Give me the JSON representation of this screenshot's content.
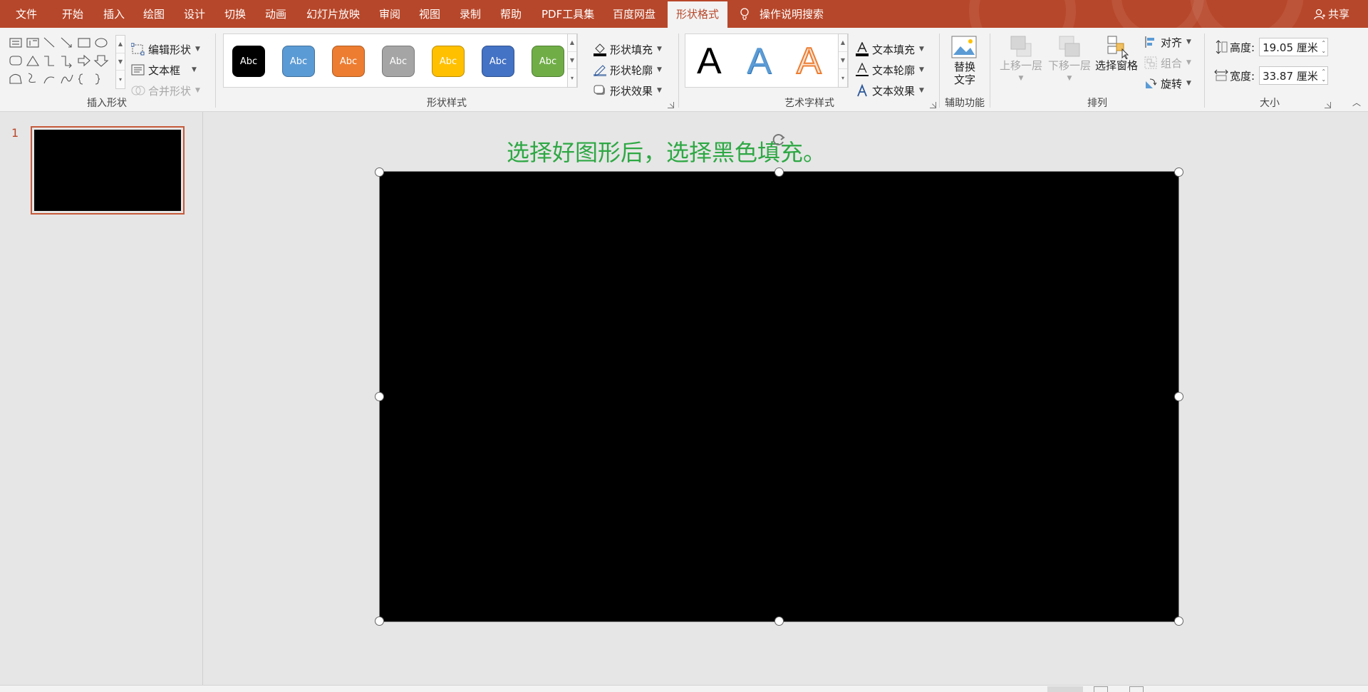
{
  "tabs": [
    {
      "label": "文件",
      "name": "tab-file"
    },
    {
      "label": "开始",
      "name": "tab-home"
    },
    {
      "label": "插入",
      "name": "tab-insert"
    },
    {
      "label": "绘图",
      "name": "tab-draw"
    },
    {
      "label": "设计",
      "name": "tab-design"
    },
    {
      "label": "切换",
      "name": "tab-transitions"
    },
    {
      "label": "动画",
      "name": "tab-animations"
    },
    {
      "label": "幻灯片放映",
      "name": "tab-slideshow"
    },
    {
      "label": "审阅",
      "name": "tab-review"
    },
    {
      "label": "视图",
      "name": "tab-view"
    },
    {
      "label": "录制",
      "name": "tab-record"
    },
    {
      "label": "帮助",
      "name": "tab-help"
    },
    {
      "label": "PDF工具集",
      "name": "tab-pdf-tools"
    },
    {
      "label": "百度网盘",
      "name": "tab-baidu-netdisk"
    },
    {
      "label": "形状格式",
      "name": "tab-shape-format",
      "active": true
    }
  ],
  "tell_me": "操作说明搜索",
  "share": "共享",
  "groups": {
    "insert_shapes": {
      "label": "插入形状",
      "edit_shape": "编辑形状",
      "text_box": "文本框",
      "merge_shapes": "合并形状"
    },
    "shape_styles": {
      "label": "形状样式",
      "swatch_text": "Abc",
      "swatch_colors": [
        "#000000",
        "#5b9bd5",
        "#ed7d31",
        "#a5a5a5",
        "#ffc000",
        "#4472c4",
        "#70ad47"
      ],
      "fill": "形状填充",
      "outline": "形状轮廓",
      "effects": "形状效果"
    },
    "wordart": {
      "label": "艺术字样式",
      "sample": "A",
      "text_fill": "文本填充",
      "text_outline": "文本轮廓",
      "text_effects": "文本效果"
    },
    "accessibility": {
      "label": "辅助功能",
      "alt_text_line1": "替换",
      "alt_text_line2": "文字"
    },
    "arrange": {
      "label": "排列",
      "bring_forward": "上移一层",
      "send_backward": "下移一层",
      "selection_pane": "选择窗格",
      "align": "对齐",
      "group": "组合",
      "rotate": "旋转"
    },
    "size": {
      "label": "大小",
      "height_label": "高度:",
      "height_value": "19.05 厘米",
      "width_label": "宽度:",
      "width_value": "33.87 厘米"
    }
  },
  "thumbnail": {
    "number": "1"
  },
  "slide": {
    "instruction": "选择好图形后，选择黑色填充。",
    "shape_fill": "#000000"
  },
  "colors": {
    "accent": "#b7472a",
    "instruction_text": "#2ea844"
  }
}
